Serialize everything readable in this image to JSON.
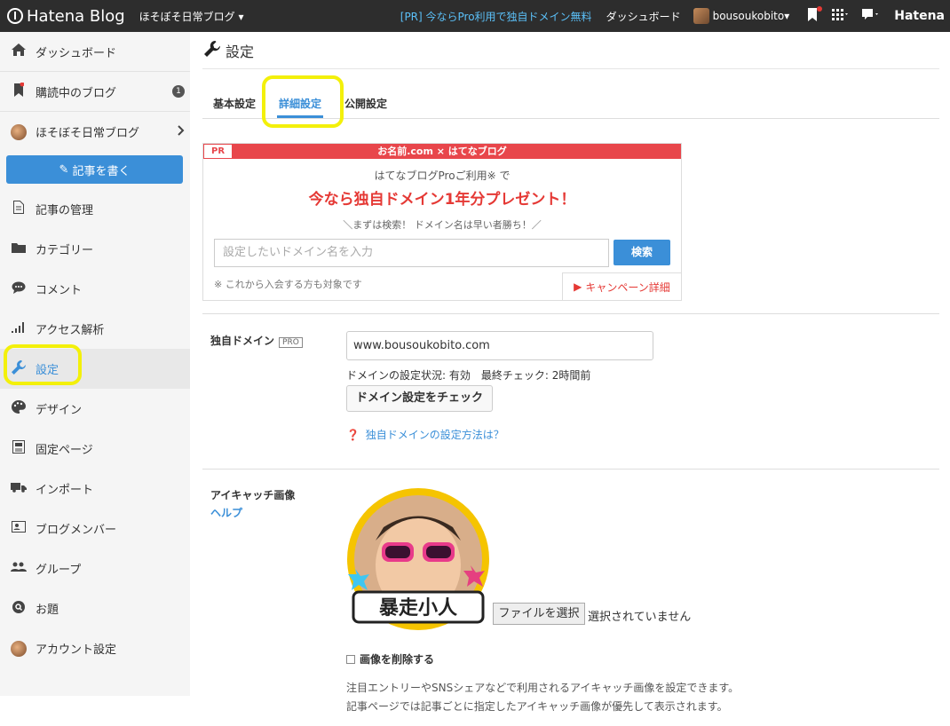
{
  "topbar": {
    "logo": "Hatena Blog",
    "blog_name": "ほそぼそ日常ブログ",
    "promo": "[PR] 今ならPro利用で独自ドメイン無料",
    "dashboard": "ダッシュボード",
    "user": "bousoukobito",
    "brand": "Hatena"
  },
  "sidebar": {
    "items": [
      {
        "label": "ダッシュボード"
      },
      {
        "label": "購読中のブログ",
        "badge": "1"
      },
      {
        "label": "ほそぼそ日常ブログ"
      },
      {
        "label": "記事の管理"
      },
      {
        "label": "カテゴリー"
      },
      {
        "label": "コメント"
      },
      {
        "label": "アクセス解析"
      },
      {
        "label": "設定"
      },
      {
        "label": "デザイン"
      },
      {
        "label": "固定ページ"
      },
      {
        "label": "インポート"
      },
      {
        "label": "ブログメンバー"
      },
      {
        "label": "グループ"
      },
      {
        "label": "お題"
      },
      {
        "label": "アカウント設定"
      }
    ],
    "write_button": "記事を書く"
  },
  "main": {
    "title": "設定",
    "tabs": [
      {
        "label": "基本設定"
      },
      {
        "label": "詳細設定"
      },
      {
        "label": "公開設定"
      }
    ],
    "promo": {
      "pr_tag": "PR",
      "header": "お名前.com × はてなブログ",
      "sub": "はてなブログProご利用※ で",
      "headline": "今なら独自ドメイン1年分プレゼント！",
      "note": "＼まずは検索！ ドメイン名は早い者勝ち！／",
      "search_placeholder": "設定したいドメイン名を入力",
      "search_button": "検索",
      "footnote": "※ これから入会する方も対象です",
      "campaign_link": "キャンペーン詳細"
    },
    "domain": {
      "label": "独自ドメイン",
      "pro_tag": "PRO",
      "value": "www.bousoukobito.com",
      "status": "ドメインの設定状況: 有効　最終チェック: 2時間前",
      "check_button": "ドメイン設定をチェック",
      "help_link": "独自ドメインの設定方法は？"
    },
    "eyecatch": {
      "label": "アイキャッチ画像",
      "help": "ヘルプ",
      "image_text": "暴走小人",
      "file_button": "ファイルを選択",
      "file_status": "選択されていません",
      "delete_label": "画像を削除する",
      "description": "注目エントリーやSNSシェアなどで利用されるアイキャッチ画像を設定できます。",
      "description2": "記事ページでは記事ごとに指定したアイキャッチ画像が優先して表示されます。"
    }
  },
  "colors": {
    "topbar": "#2d2d2d",
    "accent": "#3b8fd8",
    "promo_red": "#e8464b",
    "highlight": "#f3f00a"
  }
}
